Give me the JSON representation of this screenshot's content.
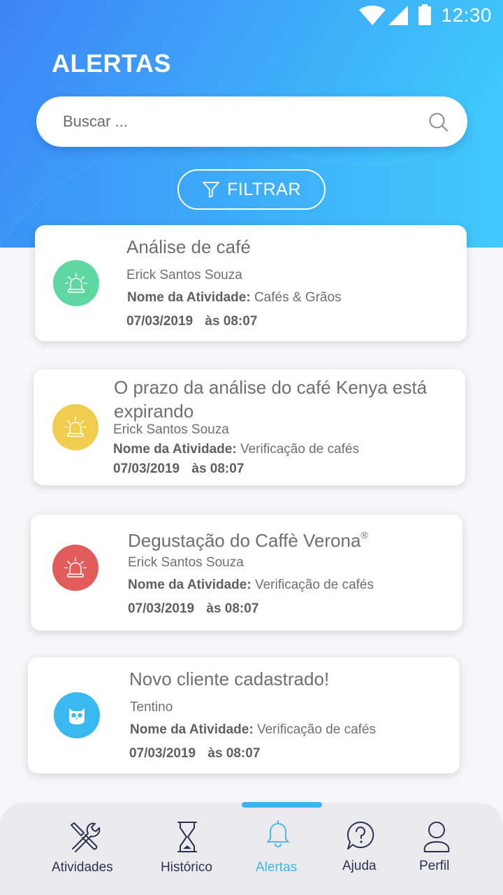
{
  "status_bar": {
    "time": "12:30"
  },
  "header": {
    "title": "ALERTAS"
  },
  "search": {
    "placeholder": "Buscar ..."
  },
  "filter": {
    "label": "FILTRAR"
  },
  "activity_label": "Nome da Atividade:",
  "at_word": "às",
  "alerts": [
    {
      "title": "Análise de café",
      "person": "Erick Santos Souza",
      "activity": "Cafés & Grãos",
      "date": "07/03/2019",
      "time": "08:07",
      "icon": "siren-icon",
      "color": "#5ed8a0"
    },
    {
      "title": "O prazo da análise do café Kenya está expirando",
      "person": "Erick Santos Souza",
      "activity": "Verificação de cafés",
      "date": "07/03/2019",
      "time": "08:07",
      "icon": "siren-icon",
      "color": "#f1cd4f"
    },
    {
      "title": "Degustação do Caffè Verona",
      "title_mark": "®",
      "person": "Erick Santos Souza",
      "activity": "Verificação de cafés",
      "date": "07/03/2019",
      "time": "08:07",
      "icon": "siren-icon",
      "color": "#e25c5c"
    },
    {
      "title": "Novo cliente cadastrado!",
      "person": "Tentino",
      "activity": "Verificação de cafés",
      "date": "07/03/2019",
      "time": "08:07",
      "icon": "owl-icon",
      "color": "#3ab8f0"
    }
  ],
  "nav": [
    {
      "label": "Atividades",
      "icon": "tools-icon",
      "active": false
    },
    {
      "label": "Histórico",
      "icon": "hourglass-icon",
      "active": false
    },
    {
      "label": "Alertas",
      "icon": "bell-icon",
      "active": true
    },
    {
      "label": "Ajuda",
      "icon": "help-icon",
      "active": false
    },
    {
      "label": "Perfil",
      "icon": "user-icon",
      "active": false
    }
  ],
  "colors": {
    "header_gradient_start": "#3d8bf7",
    "header_gradient_end": "#3fc8fb",
    "accent": "#38b6f2",
    "nav_text": "#2a3152"
  }
}
